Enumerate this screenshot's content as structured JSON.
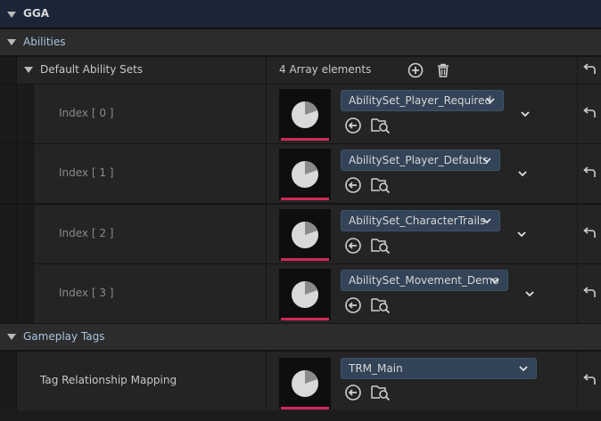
{
  "section": {
    "title": "GGA"
  },
  "categories": {
    "abilities": "Abilities",
    "gameplay_tags": "Gameplay Tags"
  },
  "default_ability_sets": {
    "label": "Default Ability Sets",
    "count_text": "4 Array elements"
  },
  "entries": [
    {
      "index_label": "Index [ 0 ]",
      "value": "AbilitySet_Player_Required"
    },
    {
      "index_label": "Index [ 1 ]",
      "value": "AbilitySet_Player_Defaults"
    },
    {
      "index_label": "Index [ 2 ]",
      "value": "AbilitySet_CharacterTrails"
    },
    {
      "index_label": "Index [ 3 ]",
      "value": "AbilitySet_Movement_Demo"
    }
  ],
  "tag_relationship": {
    "label": "Tag Relationship Mapping",
    "value": "TRM_Main"
  },
  "colors": {
    "header_bg": "#1a2538",
    "category_text": "#a8c4e0",
    "combo_bg": "#334458",
    "thumb_underline": "#d0295a"
  }
}
